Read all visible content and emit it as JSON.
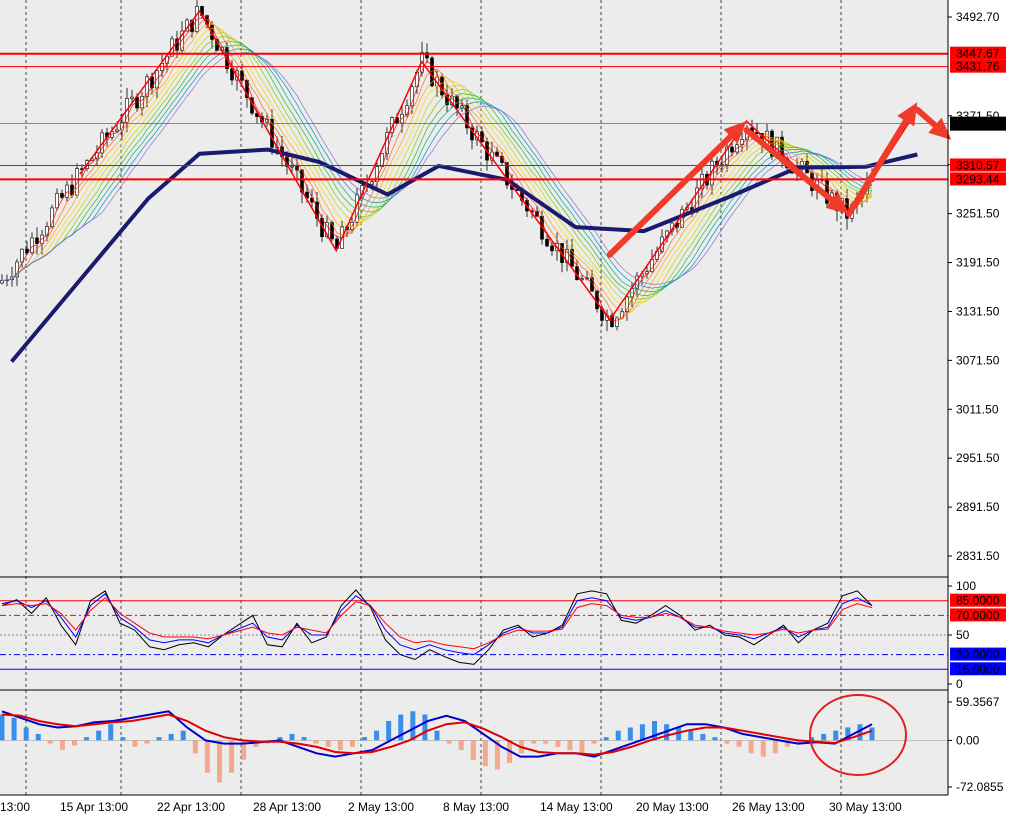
{
  "chart_data": [
    {
      "type": "candlestick",
      "panel": "price",
      "ylim": [
        2800,
        3510
      ],
      "y_ticks": [
        "3492.70",
        "3431.76",
        "3371.50",
        "3311.50",
        "3251.50",
        "3191.50",
        "3131.50",
        "3071.50",
        "3011.50",
        "2951.50",
        "2891.50",
        "2831.50"
      ],
      "current_price": "3361.87",
      "horizontal_levels": [
        {
          "label": "3447.67",
          "value": 3447.67,
          "color": "#ff0000",
          "weight": "thick"
        },
        {
          "label": "3431.76",
          "value": 3431.76,
          "color": "#ff0000",
          "weight": "thin"
        },
        {
          "label": "3310.57",
          "value": 3310.57,
          "color": "#ff0000",
          "weight": "thin"
        },
        {
          "label": "3293.44",
          "value": 3293.44,
          "color": "#ff0000",
          "weight": "thick"
        }
      ],
      "zigzag_points": [
        {
          "x": "14 Apr",
          "y": 3300
        },
        {
          "x": "21 Apr",
          "y": 3500
        },
        {
          "x": "29 Apr",
          "y": 3206
        },
        {
          "x": "4 May",
          "y": 3438
        },
        {
          "x": "15 May",
          "y": 3121
        },
        {
          "x": "23 May",
          "y": 3365
        },
        {
          "x": "29 May",
          "y": 3249
        },
        {
          "x": "2 Jun",
          "y": 3379
        }
      ],
      "arrows": [
        {
          "from": {
            "x": "15 May",
            "y": 3201
          },
          "to": {
            "x": "23 May",
            "y": 3365
          }
        },
        {
          "from": {
            "x": "23 May",
            "y": 3354
          },
          "to": {
            "x": "29 May",
            "y": 3251
          }
        },
        {
          "from": {
            "x": "29 May",
            "y": 3251
          },
          "to": {
            "x": "2 Jun",
            "y": 3388
          }
        },
        {
          "from": {
            "x": "2 Jun",
            "y": 3379
          },
          "to": {
            "x": "4 Jun",
            "y": 3342
          }
        }
      ],
      "moving_average": [
        {
          "x": "10 Apr",
          "y": 3070
        },
        {
          "x": "14 Apr",
          "y": 3170
        },
        {
          "x": "18 Apr",
          "y": 3270
        },
        {
          "x": "21 Apr",
          "y": 3325
        },
        {
          "x": "25 Apr",
          "y": 3330
        },
        {
          "x": "28 Apr",
          "y": 3315
        },
        {
          "x": "2 May",
          "y": 3275
        },
        {
          "x": "5 May",
          "y": 3310
        },
        {
          "x": "9 May",
          "y": 3293
        },
        {
          "x": "13 May",
          "y": 3235
        },
        {
          "x": "17 May",
          "y": 3230
        },
        {
          "x": "22 May",
          "y": 3272
        },
        {
          "x": "26 May",
          "y": 3308
        },
        {
          "x": "30 May",
          "y": 3309
        },
        {
          "x": "2 Jun",
          "y": 3324
        }
      ],
      "x_ticks": [
        "13:00",
        "15 Apr 13:00",
        "22 Apr 13:00",
        "28 Apr 13:00",
        "2 May 13:00",
        "8 May 13:00",
        "14 May 13:00",
        "20 May 13:00",
        "26 May 13:00",
        "30 May 13:00"
      ]
    },
    {
      "type": "line",
      "panel": "stochastic",
      "ylim": [
        0,
        100
      ],
      "y_ticks": [
        "100",
        "50",
        "0"
      ],
      "levels": [
        {
          "label": "85.0000",
          "value": 85,
          "color": "#ff0000",
          "style": "solid"
        },
        {
          "label": "70.0000",
          "value": 70,
          "color": "#ff0000",
          "style": "dashdot"
        },
        {
          "label": "30.0000",
          "value": 30,
          "color": "#0000ff",
          "style": "dashdot"
        },
        {
          "label": "15.0000",
          "value": 15,
          "color": "#0000ff",
          "style": "solid"
        }
      ],
      "series": [
        {
          "values": [
            80,
            86,
            72,
            88,
            60,
            40,
            85,
            95,
            62,
            55,
            38,
            35,
            40,
            42,
            38,
            50,
            60,
            70,
            40,
            38,
            62,
            42,
            48,
            80,
            96,
            78,
            45,
            30,
            25,
            35,
            28,
            22,
            20,
            35,
            55,
            60,
            48,
            52,
            60,
            92,
            95,
            92,
            65,
            62,
            70,
            80,
            70,
            55,
            60,
            50,
            48,
            40,
            50,
            60,
            42,
            55,
            62,
            90,
            95,
            80
          ],
          "color": "#000000"
        },
        {
          "values": [
            82,
            85,
            78,
            85,
            68,
            48,
            80,
            92,
            68,
            58,
            45,
            42,
            45,
            45,
            42,
            50,
            56,
            62,
            48,
            45,
            60,
            50,
            50,
            75,
            90,
            80,
            55,
            40,
            35,
            40,
            35,
            32,
            30,
            40,
            52,
            58,
            52,
            52,
            58,
            85,
            88,
            85,
            68,
            65,
            68,
            75,
            68,
            58,
            58,
            52,
            50,
            46,
            52,
            58,
            48,
            55,
            58,
            82,
            88,
            80
          ],
          "color": "#0000ff"
        },
        {
          "values": [
            80,
            82,
            80,
            82,
            72,
            55,
            75,
            88,
            72,
            62,
            52,
            48,
            48,
            48,
            46,
            50,
            54,
            58,
            52,
            50,
            58,
            55,
            52,
            70,
            84,
            80,
            62,
            48,
            42,
            44,
            40,
            38,
            36,
            42,
            50,
            55,
            54,
            54,
            56,
            78,
            82,
            80,
            70,
            68,
            68,
            72,
            68,
            60,
            58,
            54,
            52,
            50,
            52,
            56,
            52,
            55,
            56,
            76,
            82,
            78
          ],
          "color": "#ff0000"
        }
      ]
    },
    {
      "type": "bar",
      "panel": "macd",
      "ylim": [
        -72.0855,
        59.3567
      ],
      "y_ticks": [
        "59.3567",
        "0.00",
        "-72.0855"
      ],
      "histogram": [
        40,
        35,
        20,
        10,
        -5,
        -15,
        -8,
        5,
        15,
        25,
        5,
        -10,
        -5,
        5,
        10,
        15,
        -20,
        -50,
        -65,
        -50,
        -30,
        -10,
        -5,
        5,
        10,
        5,
        -5,
        -10,
        -15,
        -10,
        5,
        15,
        30,
        40,
        45,
        40,
        15,
        -5,
        -15,
        -30,
        -40,
        -45,
        -35,
        -20,
        -5,
        -5,
        -10,
        -15,
        -20,
        -5,
        5,
        15,
        20,
        25,
        30,
        25,
        20,
        15,
        10,
        5,
        -5,
        -10,
        -20,
        -25,
        -20,
        -10,
        -5,
        5,
        10,
        15,
        20,
        25,
        20
      ],
      "series": [
        {
          "values": [
            45,
            35,
            25,
            20,
            22,
            28,
            30,
            35,
            40,
            45,
            20,
            0,
            -5,
            -5,
            -3,
            0,
            -10,
            -20,
            -25,
            -20,
            -15,
            0,
            15,
            30,
            38,
            30,
            10,
            -10,
            -25,
            -25,
            -20,
            -20,
            -25,
            -15,
            -5,
            5,
            15,
            25,
            25,
            20,
            10,
            5,
            0,
            -5,
            -3,
            -5,
            10,
            25
          ],
          "color": "#0000c8"
        },
        {
          "values": [
            40,
            38,
            30,
            25,
            22,
            25,
            28,
            30,
            35,
            40,
            30,
            15,
            5,
            0,
            -2,
            -2,
            -5,
            -10,
            -18,
            -20,
            -18,
            -10,
            0,
            15,
            25,
            28,
            18,
            5,
            -10,
            -18,
            -20,
            -20,
            -22,
            -18,
            -10,
            0,
            8,
            15,
            20,
            20,
            15,
            10,
            5,
            0,
            -2,
            -4,
            5,
            15
          ],
          "color": "#e00000"
        }
      ],
      "annotation": "circle"
    }
  ]
}
